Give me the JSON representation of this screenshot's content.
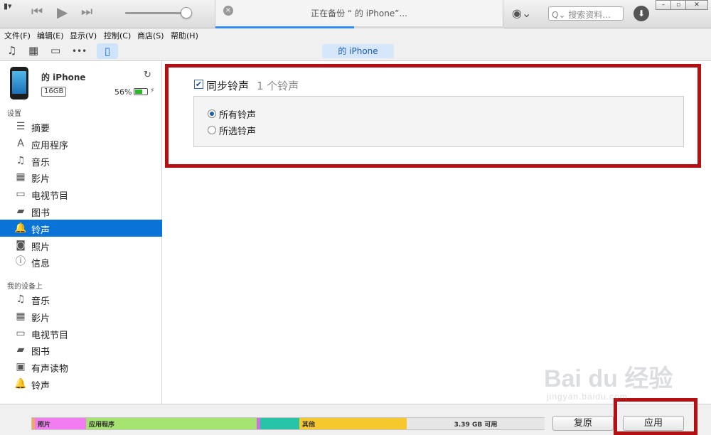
{
  "titlebar": {
    "menu_icon": "▮▾",
    "prev_icon": "⏮",
    "play_icon": "▶",
    "next_icon": "⏭",
    "lcd_close": "×",
    "lcd_title": "正在备份 “     的 iPhone”...",
    "lcd_progress": 0.48,
    "account_icon": "◉⌄",
    "search_placeholder": "Q⌄ 搜索资料...",
    "download_icon": "⬇",
    "minimize": "–",
    "restore": "▫",
    "close": "✕"
  },
  "menubar": {
    "items": [
      "文件(F)",
      "编辑(E)",
      "显示(V)",
      "控制(C)",
      "商店(S)",
      "帮助(H)"
    ]
  },
  "toolbar": {
    "music_icon": "♫",
    "movie_icon": "▦",
    "tv_icon": "▭",
    "more_icon": "•••",
    "device_icon": "▯",
    "device_pill": "     的 iPhone"
  },
  "device": {
    "name": "        的 iPhone",
    "capacity": "16GB",
    "battery_percent": "56%",
    "battery_level": 0.56,
    "sync_icon": "↻",
    "bolt": "⚡"
  },
  "sidebar": {
    "settings_label": "设置",
    "settings_items": [
      {
        "icon": "☰",
        "label": "摘要"
      },
      {
        "icon": "A",
        "label": "应用程序"
      },
      {
        "icon": "♫",
        "label": "音乐"
      },
      {
        "icon": "▦",
        "label": "影片"
      },
      {
        "icon": "▭",
        "label": "电视节目"
      },
      {
        "icon": "▰",
        "label": "图书"
      },
      {
        "icon": "🔔",
        "label": "铃声"
      },
      {
        "icon": "◙",
        "label": "照片"
      },
      {
        "icon": "ⓘ",
        "label": "信息"
      }
    ],
    "device_label": "我的设备上",
    "device_items": [
      {
        "icon": "♫",
        "label": "音乐"
      },
      {
        "icon": "▦",
        "label": "影片"
      },
      {
        "icon": "▭",
        "label": "电视节目"
      },
      {
        "icon": "▰",
        "label": "图书"
      },
      {
        "icon": "▣",
        "label": "有声读物"
      },
      {
        "icon": "🔔",
        "label": "铃声"
      }
    ],
    "active_index": 6
  },
  "main": {
    "sync_check": "✔",
    "sync_label": "同步铃声",
    "sync_count": "1 个铃声",
    "options": [
      {
        "label": "所有铃声",
        "selected": true
      },
      {
        "label": "所选铃声",
        "selected": false
      }
    ]
  },
  "storage": {
    "segments": [
      {
        "label": "",
        "color": "#f2a85a",
        "fraction": 0.005
      },
      {
        "label": "照片",
        "color": "#f27df0",
        "fraction": 0.1
      },
      {
        "label": "应用程序",
        "color": "#a4e36f",
        "fraction": 0.333
      },
      {
        "label": "",
        "color": "#cf6fe0",
        "fraction": 0.007
      },
      {
        "label": "",
        "color": "#28c4a8",
        "fraction": 0.076
      },
      {
        "label": "其他",
        "color": "#f7c82e",
        "fraction": 0.21
      },
      {
        "label": "3.39 GB 可用",
        "color": "#e6e6e6",
        "fraction": 0.269
      }
    ]
  },
  "buttons": {
    "revert": "复原",
    "apply": "应用"
  },
  "watermark": {
    "main": "Bai du 经验",
    "sub": "jingyan.baidu.com"
  }
}
